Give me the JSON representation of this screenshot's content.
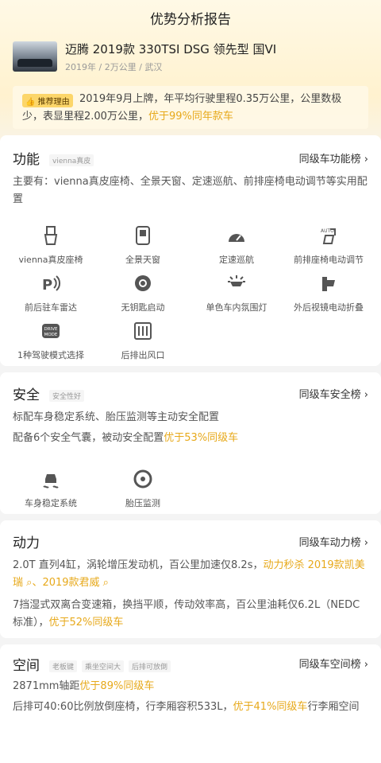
{
  "page": {
    "title": "优势分析报告"
  },
  "car": {
    "name": "迈腾 2019款 330TSI DSG 领先型 国VI",
    "meta": "2019年 / 2万公里 / 武汉"
  },
  "recommend": {
    "badge": "推荐理由",
    "text": "2019年9月上牌，年平均行驶里程0.35万公里，公里数极少，表显里程2.00万公里，",
    "highlight": "优于99%同年款车"
  },
  "function": {
    "title": "功能",
    "tag": "vienna真皮",
    "rank": "同级车功能榜 ›",
    "desc": "主要有：vienna真皮座椅、全景天窗、定速巡航、前排座椅电动调节等实用配置",
    "features": [
      {
        "label": "vienna真皮座椅",
        "icon": "seat-icon"
      },
      {
        "label": "全景天窗",
        "icon": "sunroof-icon"
      },
      {
        "label": "定速巡航",
        "icon": "cruise-icon"
      },
      {
        "label": "前排座椅电动调节",
        "icon": "auto-seat-icon"
      },
      {
        "label": "前后驻车雷达",
        "icon": "parking-radar-icon"
      },
      {
        "label": "无钥匙启动",
        "icon": "keyless-start-icon"
      },
      {
        "label": "单色车内氛围灯",
        "icon": "ambient-light-icon"
      },
      {
        "label": "外后视镜电动折叠",
        "icon": "mirror-fold-icon"
      },
      {
        "label": "1种驾驶模式选择",
        "icon": "drive-mode-icon"
      },
      {
        "label": "后排出风口",
        "icon": "rear-vent-icon"
      }
    ]
  },
  "safety": {
    "title": "安全",
    "tag": "安全性好",
    "rank": "同级车安全榜 ›",
    "line1": "标配车身稳定系统、胎压监测等主动安全配置",
    "line2": "配备6个安全气囊，被动安全配置",
    "line2_hl": "优于53%同级车",
    "features": [
      {
        "label": "车身稳定系统",
        "icon": "stability-icon"
      },
      {
        "label": "胎压监测",
        "icon": "tire-pressure-icon"
      }
    ]
  },
  "power": {
    "title": "动力",
    "rank": "同级车动力榜 ›",
    "line1": "2.0T 直列4缸，涡轮增压发动机，百公里加速仅8.2s，",
    "line1_hl": "动力秒杀 2019款凯美瑞",
    "line1_hl2": "、2019款君威",
    "line2": "7挡湿式双离合变速箱，换挡平顺，传动效率高，百公里油耗仅6.2L（NEDC标准），",
    "line2_hl": "优于52%同级车"
  },
  "space": {
    "title": "空间",
    "tags": [
      "老板键",
      "乘坐空间大",
      "后排可放倒"
    ],
    "rank": "同级车空间榜 ›",
    "line1": "2871mm轴距",
    "line1_hl": "优于89%同级车",
    "line2": "后排可40:60比例放倒座椅，行李厢容积533L，",
    "line2_hl": "优于41%同级车",
    "line2_tail": "行李厢空间"
  }
}
